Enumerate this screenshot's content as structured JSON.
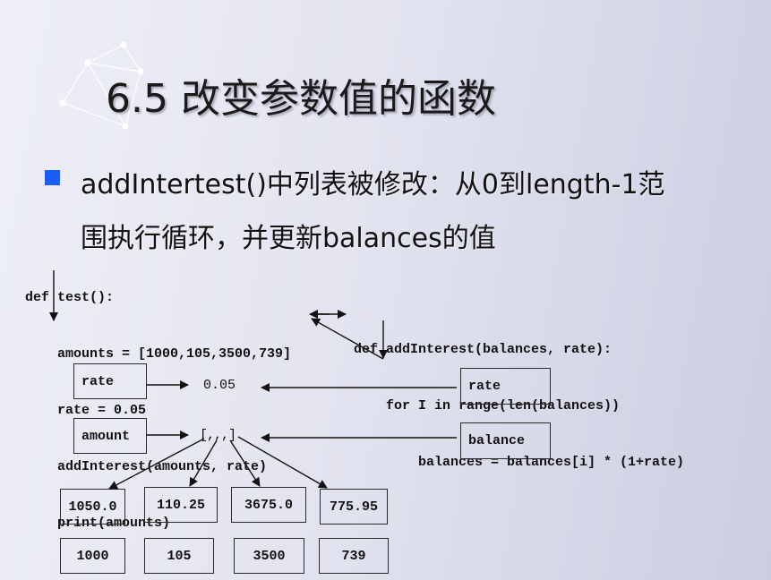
{
  "slide": {
    "title": "6.5 改变参数值的函数",
    "bullet_color": "#1a5ef5",
    "bullet_line1": "addIntertest()中列表被修改：从0到length-1范",
    "bullet_line2": "围执行循环，并更新balances的值"
  },
  "code_test": {
    "lines": [
      "def test():",
      "    amounts = [1000,105,3500,739]",
      "    rate = 0.05",
      "    addInterest(amounts, rate)",
      "    print(amounts)"
    ]
  },
  "code_add_interest": {
    "lines": [
      "def addInterest(balances, rate):",
      "    for I in range(len(balances))",
      "        balances = balances[i] * (1+rate)"
    ]
  },
  "diagram": {
    "left_vars": {
      "rate": "rate",
      "amount": "amount"
    },
    "right_vars": {
      "rate": "rate",
      "balance": "balance"
    },
    "rate_value": "0.05",
    "list_value": "[,,,]",
    "new_values": [
      "1050.0",
      "110.25",
      "3675.0",
      "775.95"
    ],
    "old_values": [
      "1000",
      "105",
      "3500",
      "739"
    ]
  }
}
